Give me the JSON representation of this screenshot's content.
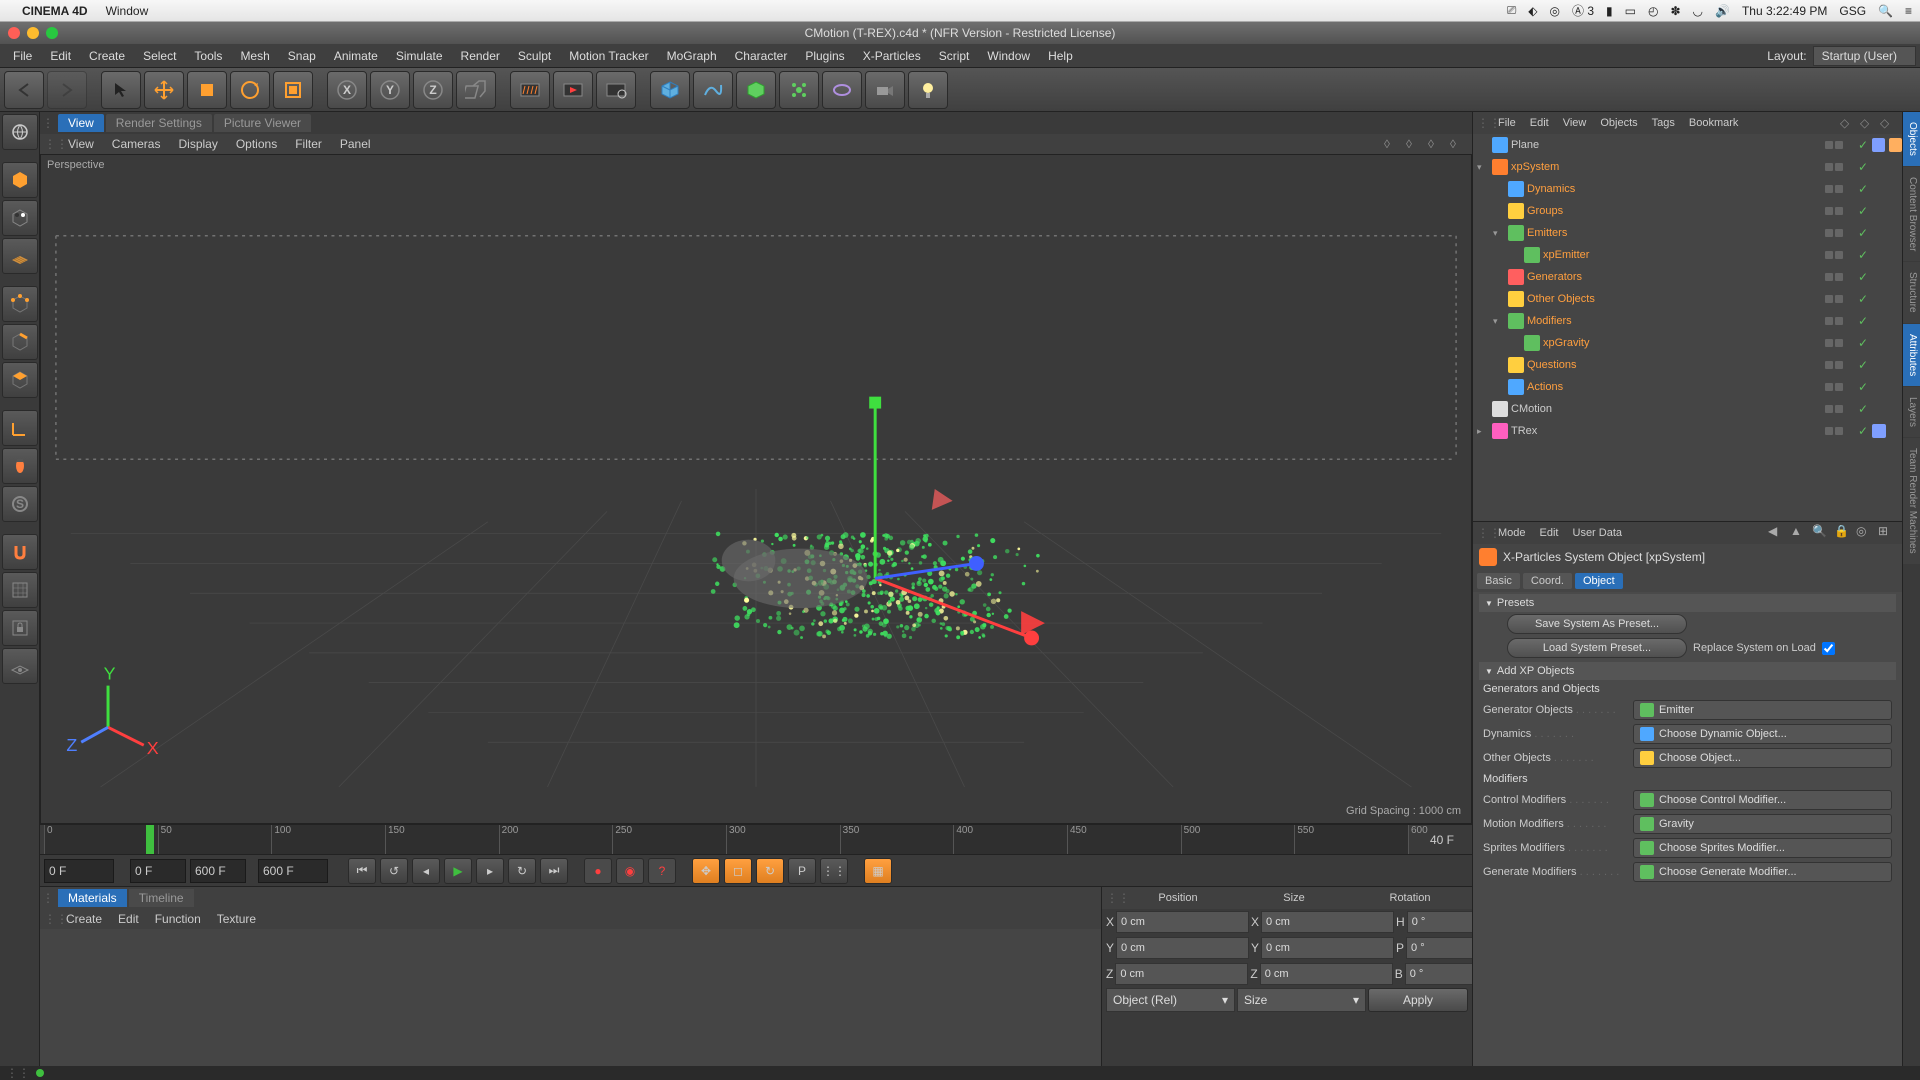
{
  "mac_menu": {
    "app_name": "CINEMA 4D",
    "items": [
      "Window"
    ],
    "clock": "Thu 3:22:49 PM",
    "user": "GSG"
  },
  "window": {
    "title": "CMotion (T-REX).c4d * (NFR Version - Restricted License)"
  },
  "main_menu": {
    "items": [
      "File",
      "Edit",
      "Create",
      "Select",
      "Tools",
      "Mesh",
      "Snap",
      "Animate",
      "Simulate",
      "Render",
      "Sculpt",
      "Motion Tracker",
      "MoGraph",
      "Character",
      "Plugins",
      "X-Particles",
      "Script",
      "Window",
      "Help"
    ],
    "layout_label": "Layout:",
    "layout_value": "Startup (User)"
  },
  "viewport_tabs": {
    "items": [
      "View",
      "Render Settings",
      "Picture Viewer"
    ],
    "active": 0
  },
  "viewport_menu": {
    "items": [
      "View",
      "Cameras",
      "Display",
      "Options",
      "Filter",
      "Panel"
    ]
  },
  "viewport": {
    "label": "Perspective",
    "grid_spacing": "Grid Spacing : 1000 cm"
  },
  "timeline": {
    "start": 0,
    "end": 600,
    "current": 40,
    "current_label": "40 F",
    "ticks": [
      0,
      50,
      100,
      150,
      200,
      250,
      300,
      350,
      400,
      450,
      500,
      550,
      600
    ],
    "start_field": "0 F",
    "range_start": "0 F",
    "range_end": "600 F",
    "end_field": "600 F"
  },
  "materials_tabs": {
    "items": [
      "Materials",
      "Timeline"
    ],
    "active": 0
  },
  "materials_menu": {
    "items": [
      "Create",
      "Edit",
      "Function",
      "Texture"
    ]
  },
  "coord": {
    "headers": [
      "Position",
      "Size",
      "Rotation"
    ],
    "rows": [
      {
        "a1": "X",
        "v1": "0 cm",
        "a2": "X",
        "v2": "0 cm",
        "a3": "H",
        "v3": "0 °"
      },
      {
        "a1": "Y",
        "v1": "0 cm",
        "a2": "Y",
        "v2": "0 cm",
        "a3": "P",
        "v3": "0 °"
      },
      {
        "a1": "Z",
        "v1": "0 cm",
        "a2": "Z",
        "v2": "0 cm",
        "a3": "B",
        "v3": "0 °"
      }
    ],
    "mode1": "Object (Rel)",
    "mode2": "Size",
    "apply": "Apply"
  },
  "obj_manager": {
    "menu": [
      "File",
      "Edit",
      "View",
      "Objects",
      "Tags",
      "Bookmark"
    ],
    "items": [
      {
        "depth": 0,
        "icon": "#4fa8ff",
        "name": "Plane",
        "orange": false,
        "expand": "",
        "tag": true,
        "tag2": true
      },
      {
        "depth": 0,
        "icon": "#ff7f2f",
        "name": "xpSystem",
        "orange": true,
        "expand": "▾"
      },
      {
        "depth": 1,
        "icon": "#4fa8ff",
        "name": "Dynamics",
        "orange": true,
        "expand": ""
      },
      {
        "depth": 1,
        "icon": "#ffcf3f",
        "name": "Groups",
        "orange": true,
        "expand": ""
      },
      {
        "depth": 1,
        "icon": "#5fbf5f",
        "name": "Emitters",
        "orange": true,
        "expand": "▾"
      },
      {
        "depth": 2,
        "icon": "#5fbf5f",
        "name": "xpEmitter",
        "orange": true,
        "expand": ""
      },
      {
        "depth": 1,
        "icon": "#ff5f5f",
        "name": "Generators",
        "orange": true,
        "expand": ""
      },
      {
        "depth": 1,
        "icon": "#ffcf3f",
        "name": "Other Objects",
        "orange": true,
        "expand": ""
      },
      {
        "depth": 1,
        "icon": "#5fbf5f",
        "name": "Modifiers",
        "orange": true,
        "expand": "▾"
      },
      {
        "depth": 2,
        "icon": "#5fbf5f",
        "name": "xpGravity",
        "orange": true,
        "expand": ""
      },
      {
        "depth": 1,
        "icon": "#ffcf3f",
        "name": "Questions",
        "orange": true,
        "expand": ""
      },
      {
        "depth": 1,
        "icon": "#4fa8ff",
        "name": "Actions",
        "orange": true,
        "expand": ""
      },
      {
        "depth": 0,
        "icon": "#ddd",
        "name": "CMotion",
        "orange": false,
        "expand": ""
      },
      {
        "depth": 0,
        "icon": "#ff5fbf",
        "name": "TRex",
        "orange": false,
        "expand": "▸",
        "tag": true
      }
    ]
  },
  "attr_manager": {
    "menu": [
      "Mode",
      "Edit",
      "User Data"
    ],
    "title": "X-Particles System Object [xpSystem]",
    "tabs": [
      "Basic",
      "Coord.",
      "Object"
    ],
    "active_tab": 2,
    "presets": {
      "header": "Presets",
      "save": "Save System As Preset...",
      "load": "Load System Preset...",
      "replace_label": "Replace System on Load"
    },
    "add_xp": {
      "header": "Add XP Objects"
    },
    "gen_obj": {
      "header": "Generators and Objects",
      "rows": [
        {
          "label": "Generator Objects",
          "value": "Emitter",
          "color": "#5fbf5f"
        },
        {
          "label": "Dynamics",
          "value": "Choose Dynamic Object...",
          "color": "#4fa8ff"
        },
        {
          "label": "Other Objects",
          "value": "Choose Object...",
          "color": "#ffcf3f"
        }
      ]
    },
    "modifiers": {
      "header": "Modifiers",
      "rows": [
        {
          "label": "Control Modifiers",
          "value": "Choose Control Modifier...",
          "color": "#5fbf5f"
        },
        {
          "label": "Motion Modifiers",
          "value": "Gravity",
          "color": "#5fbf5f"
        },
        {
          "label": "Sprites Modifiers",
          "value": "Choose Sprites Modifier...",
          "color": "#5fbf5f"
        },
        {
          "label": "Generate Modifiers",
          "value": "Choose Generate Modifier...",
          "color": "#5fbf5f"
        }
      ]
    }
  },
  "side_tabs": [
    "Objects",
    "Content Browser",
    "Structure",
    "Attributes",
    "Layers",
    "Team Render Machines"
  ]
}
